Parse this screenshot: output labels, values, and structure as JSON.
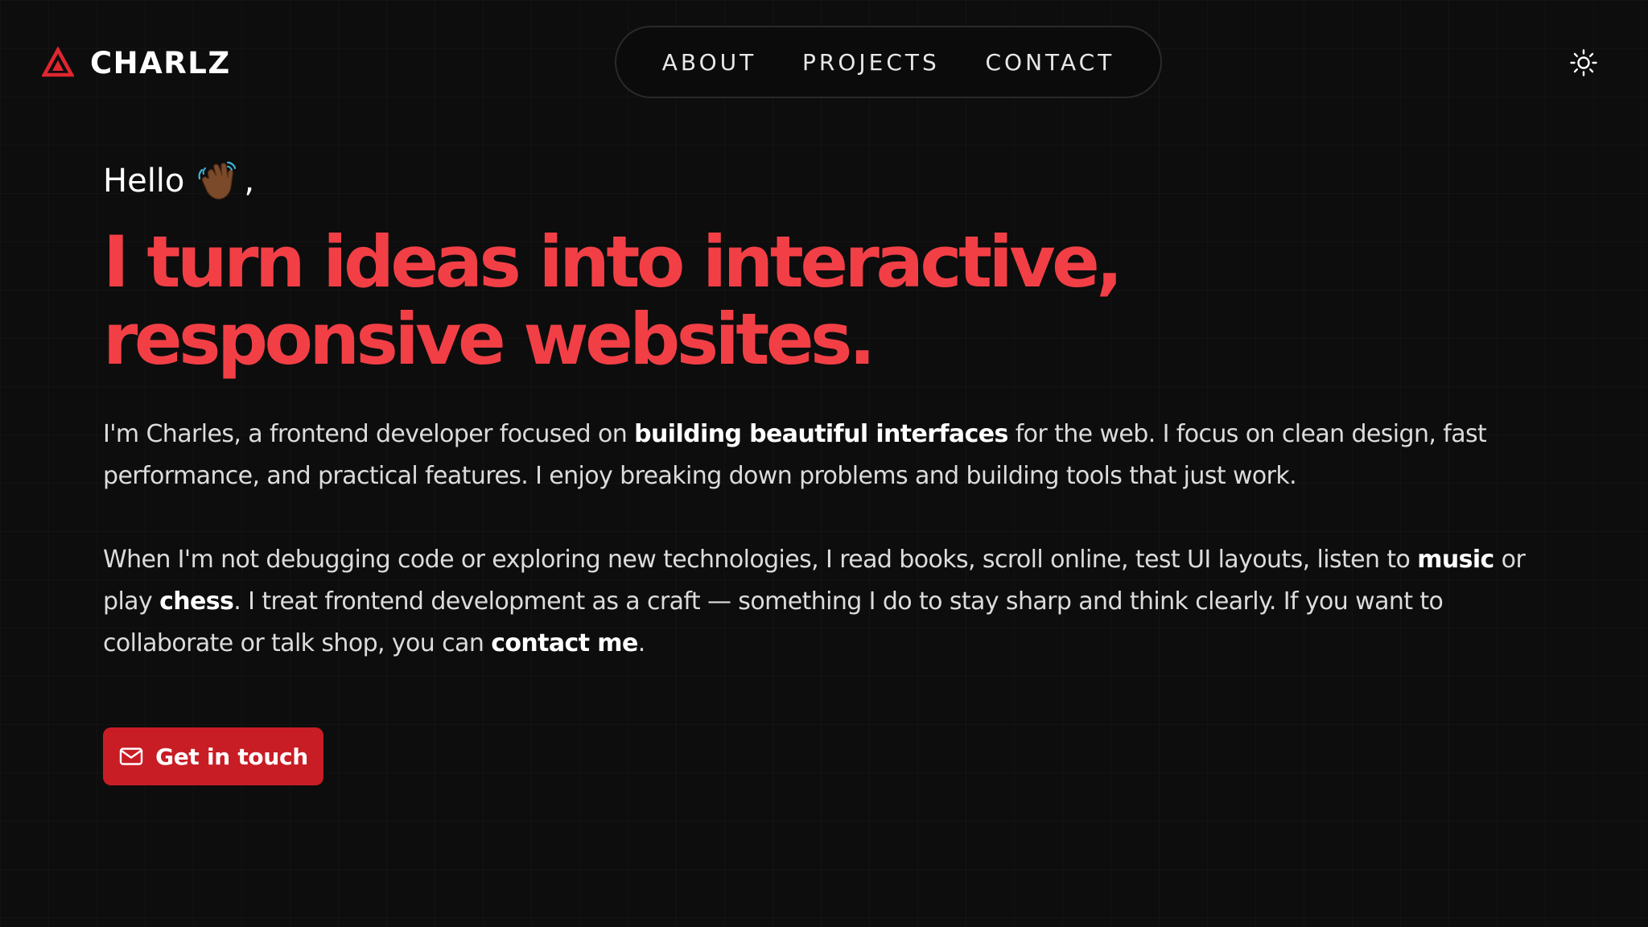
{
  "header": {
    "brand_name": "CHARLZ",
    "brand_logo_icon": "triangle-logo-icon",
    "nav": [
      {
        "label": "ABOUT"
      },
      {
        "label": "PROJECTS"
      },
      {
        "label": "CONTACT"
      }
    ],
    "theme_toggle_icon": "sun-icon"
  },
  "hero": {
    "greeting": "Hello",
    "greeting_emoji_icon": "waving-hand-icon",
    "greeting_suffix": ",",
    "headline_line1": "I turn ideas into interactive,",
    "headline_line2": "responsive websites.",
    "para1": {
      "t1": "I'm Charles, a frontend developer focused on ",
      "b1": "building beautiful interfaces",
      "t2": " for the web. I focus on clean design, fast performance, and practical features. I enjoy breaking down problems and building tools that just work."
    },
    "para2": {
      "t1": "When I'm not debugging code or exploring new technologies, I read books, scroll online, test UI layouts, listen to ",
      "b1": "music",
      "t2": " or play ",
      "b2": "chess",
      "t3": ". I treat frontend development as a craft — something I do to stay sharp and think clearly. If you want to collaborate or talk shop, you can ",
      "link": "contact me",
      "t4": "."
    },
    "cta_label": "Get in touch",
    "cta_icon": "mail-icon"
  },
  "colors": {
    "background": "#0d0d0d",
    "accent": "#f23f46",
    "button": "#c81d25",
    "text": "#dcdcdc"
  }
}
